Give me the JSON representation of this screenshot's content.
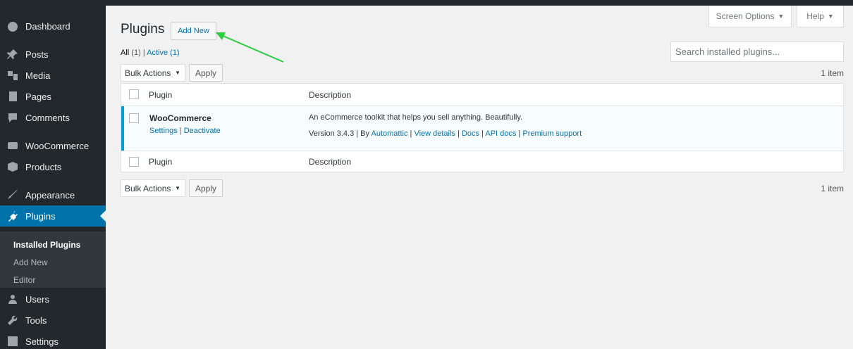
{
  "sidebar": {
    "items": [
      {
        "label": "Dashboard",
        "icon": "dashboard-icon"
      },
      {
        "label": "Posts",
        "icon": "pin-icon"
      },
      {
        "label": "Media",
        "icon": "media-icon"
      },
      {
        "label": "Pages",
        "icon": "pages-icon"
      },
      {
        "label": "Comments",
        "icon": "comment-icon"
      },
      {
        "label": "WooCommerce",
        "icon": "woocommerce-icon"
      },
      {
        "label": "Products",
        "icon": "box-icon"
      },
      {
        "label": "Appearance",
        "icon": "brush-icon"
      },
      {
        "label": "Plugins",
        "icon": "plug-icon"
      },
      {
        "label": "Users",
        "icon": "users-icon"
      },
      {
        "label": "Tools",
        "icon": "wrench-icon"
      },
      {
        "label": "Settings",
        "icon": "settings-icon"
      }
    ],
    "submenu": [
      "Installed Plugins",
      "Add New",
      "Editor"
    ]
  },
  "header": {
    "screen_options": "Screen Options",
    "help": "Help",
    "title": "Plugins",
    "add_new": "Add New"
  },
  "filters": {
    "all": "All",
    "all_count": "(1)",
    "separator": "|",
    "active": "Active",
    "active_count": "(1)"
  },
  "search": {
    "placeholder": "Search installed plugins..."
  },
  "bulk": {
    "label": "Bulk Actions",
    "apply": "Apply",
    "items": "1 item"
  },
  "table": {
    "col_plugin": "Plugin",
    "col_desc": "Description",
    "plugin": {
      "name": "WooCommerce",
      "settings": "Settings",
      "deactivate": "Deactivate",
      "description": "An eCommerce toolkit that helps you sell anything. Beautifully.",
      "version": "Version 3.4.3 | By",
      "author": "Automattic",
      "view_details": "View details",
      "docs": "Docs",
      "api_docs": "API docs",
      "premium": "Premium support"
    }
  },
  "colors": {
    "admin_bar": "#23282d",
    "accent": "#0073aa",
    "highlight": "#00a0d2",
    "arrow": "#2ecc40"
  }
}
